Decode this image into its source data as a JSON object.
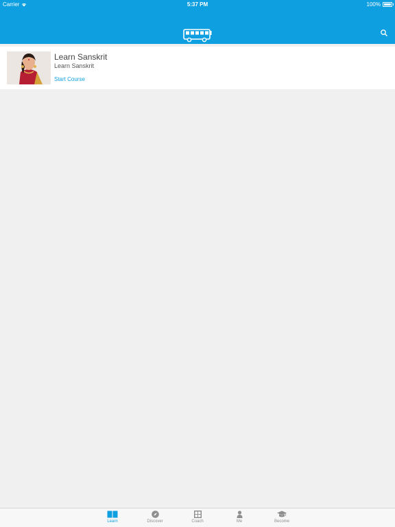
{
  "status_bar": {
    "carrier": "Carrier",
    "time": "5:37 PM",
    "battery": "100%",
    "icons": [
      "wifi-icon",
      "battery-icon"
    ]
  },
  "header": {
    "logo_icon": "bus-logo-icon",
    "search_icon": "search-icon",
    "background": "#0d9fe0"
  },
  "course": {
    "title": "Learn Sanskrit",
    "subtitle": "Learn Sanskrit",
    "action": "Start Course",
    "image_icon": "course-thumbnail"
  },
  "tabs": [
    {
      "label": "Learn",
      "icon": "book-icon",
      "active": true
    },
    {
      "label": "Discover",
      "icon": "compass-icon",
      "active": false
    },
    {
      "label": "Coach",
      "icon": "coach-grid-icon",
      "active": false
    },
    {
      "label": "Me",
      "icon": "person-icon",
      "active": false
    },
    {
      "label": "Become",
      "icon": "graduation-cap-icon",
      "active": false
    }
  ],
  "colors": {
    "accent": "#0d9fe0",
    "inactive_tab": "#8e8e8e",
    "page_background": "#f0f0f0"
  }
}
